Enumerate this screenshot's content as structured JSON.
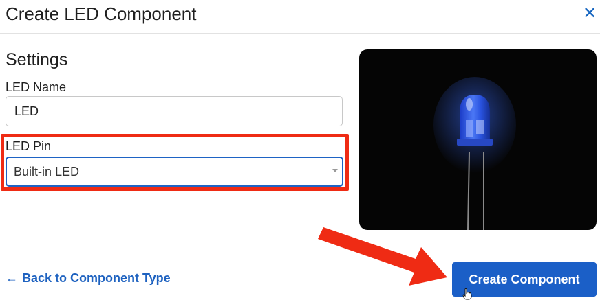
{
  "dialog": {
    "title": "Create LED Component",
    "close_icon": "close-icon"
  },
  "settings": {
    "heading": "Settings",
    "led_name": {
      "label": "LED Name",
      "value": "LED"
    },
    "led_pin": {
      "label": "LED Pin",
      "selected": "Built-in LED"
    }
  },
  "preview_image": {
    "subject": "blue LED on black background"
  },
  "footer": {
    "back_label": "Back to Component Type",
    "back_icon": "arrow-left-icon",
    "create_label": "Create Component"
  },
  "colors": {
    "accent": "#1b5fc7",
    "link": "#1e62c0",
    "annotation": "#ef2b14"
  }
}
